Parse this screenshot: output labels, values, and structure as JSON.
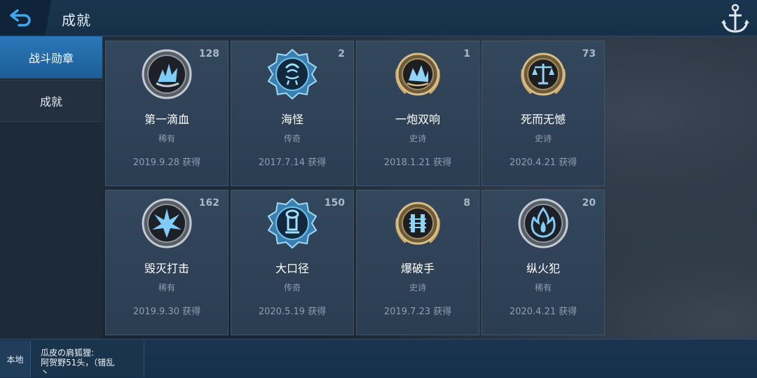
{
  "header": {
    "title": "成就",
    "back_icon": "back-arrow-icon",
    "menu_icon": "anchor-icon"
  },
  "sidebar": {
    "items": [
      {
        "label": "战斗勋章",
        "active": true
      },
      {
        "label": "成就",
        "active": false
      }
    ]
  },
  "medals": [
    {
      "name": "第一滴血",
      "rarity": "稀有",
      "date": "2019.9.28 获得",
      "count": "128",
      "icon": "splash-icon"
    },
    {
      "name": "海怪",
      "rarity": "传奇",
      "date": "2017.7.14 获得",
      "count": "2",
      "icon": "kraken-icon"
    },
    {
      "name": "一炮双响",
      "rarity": "史诗",
      "date": "2018.1.21 获得",
      "count": "1",
      "icon": "double-shot-icon"
    },
    {
      "name": "死而无憾",
      "rarity": "史诗",
      "date": "2020.4.21 获得",
      "count": "73",
      "icon": "scales-icon"
    },
    {
      "name": "毁灭打击",
      "rarity": "稀有",
      "date": "2019.9.30 获得",
      "count": "162",
      "icon": "explosion-icon"
    },
    {
      "name": "大口径",
      "rarity": "传奇",
      "date": "2020.5.19 获得",
      "count": "150",
      "icon": "cannon-icon"
    },
    {
      "name": "爆破手",
      "rarity": "史诗",
      "date": "2019.7.23 获得",
      "count": "8",
      "icon": "dynamite-icon"
    },
    {
      "name": "纵火犯",
      "rarity": "稀有",
      "date": "2020.4.21 获得",
      "count": "20",
      "icon": "fire-icon"
    }
  ],
  "chat": {
    "channel": "本地",
    "line1": "瓜皮の肩狐狸:",
    "line2": "阿贺野51头，（错乱",
    "line3": "丶"
  },
  "colors": {
    "accent": "#2b77b7",
    "card_bg": "#33475d",
    "rare_ring": "#b9c0c8",
    "epic_ring": "#c9a86a",
    "legend_ring": "#5fb4e6"
  }
}
